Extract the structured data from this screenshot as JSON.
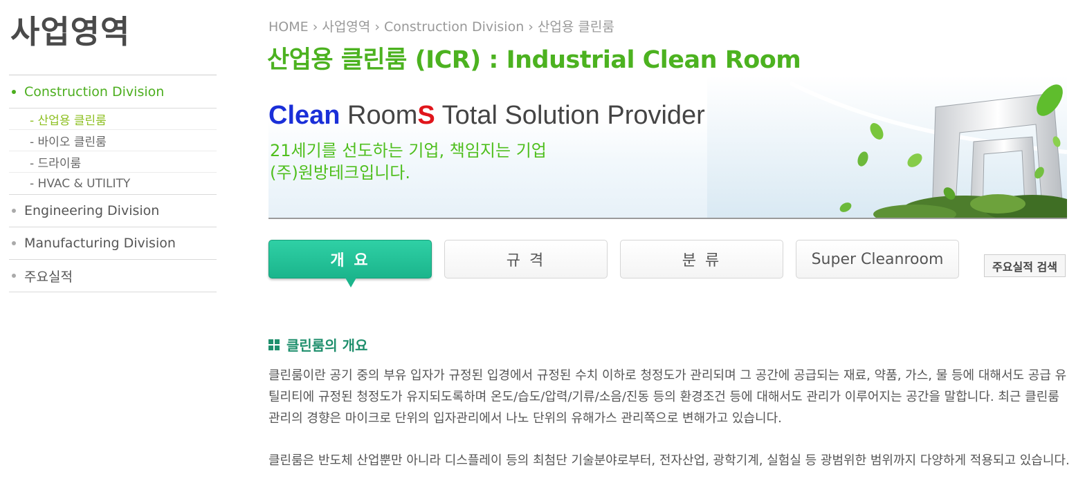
{
  "sidebar": {
    "title": "사업영역",
    "items": [
      {
        "label": "Construction Division",
        "active": true,
        "children": [
          {
            "label": "- 산업용 클린룸",
            "active": true
          },
          {
            "label": "- 바이오 클린룸"
          },
          {
            "label": "- 드라이룸"
          },
          {
            "label": "- HVAC & UTILITY"
          }
        ]
      },
      {
        "label": "Engineering Division"
      },
      {
        "label": "Manufacturing Division"
      },
      {
        "label": "주요실적"
      }
    ]
  },
  "breadcrumb": [
    "HOME",
    "사업영역",
    "Construction Division",
    "산업용 클린룸"
  ],
  "page_title": "산업용 클린룸 (ICR) : Industrial Clean Room",
  "banner": {
    "slogan_clean": "Clean",
    "slogan_room": " Room",
    "slogan_s": "S",
    "slogan_rest": " Total Solution Provider",
    "sub_line1": "21세기를 선도하는 기업, 책임지는 기업",
    "sub_line2": "(주)원방테크입니다."
  },
  "tabs": [
    "개 요",
    "규 격",
    "분 류",
    "Super Cleanroom"
  ],
  "search_button": "주요실적 검색",
  "section": {
    "heading": "클린룸의 개요",
    "paragraph1": "클린룸이란 공기 중의 부유 입자가 규정된 입경에서 규정된 수치 이하로 청정도가 관리되며 그 공간에 공급되는 재료, 약품, 가스, 물 등에 대해서도 공급 유틸리티에 규정된 청정도가 유지되도록하며 온도/습도/압력/기류/소음/진동 등의 환경조건 등에 대해서도 관리가 이루어지는 공간을 말합니다. 최근 클린룸 관리의 경향은 마이크로 단위의 입자관리에서 나노 단위의 유해가스 관리쪽으로 변해가고 있습니다.",
    "paragraph2": "클린룸은 반도체 산업뿐만 아니라 디스플레이 등의 최첨단 기술분야로부터, 전자산업, 광학기계, 실험실 등 광범위한 범위까지 다양하게 적용되고 있습니다."
  },
  "colors": {
    "accent_green": "#4cb220",
    "tab_active": "#1bb58c",
    "section_heading": "#1f8f6d"
  }
}
